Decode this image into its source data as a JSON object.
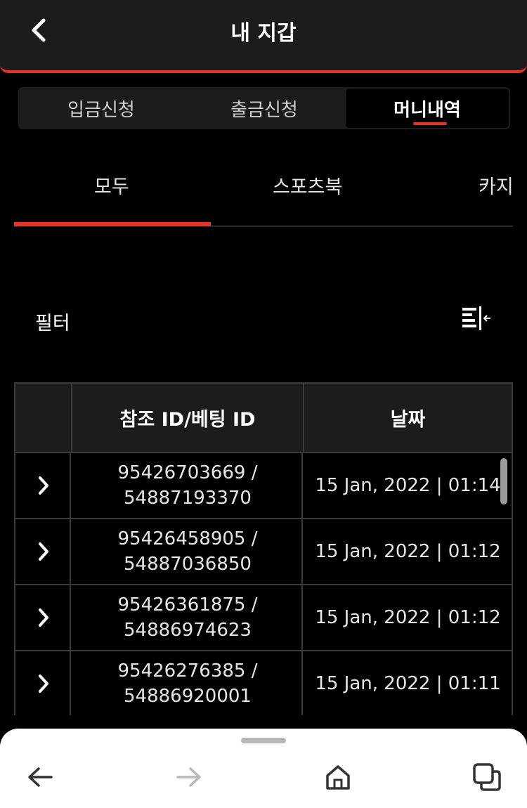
{
  "header": {
    "title": "내 지갑",
    "back_icon": "chevron-left-icon"
  },
  "segments": [
    {
      "label": "입금신청",
      "active": false
    },
    {
      "label": "출금신청",
      "active": false
    },
    {
      "label": "머니내역",
      "active": true
    }
  ],
  "category_tabs": [
    {
      "label": "모두",
      "active": true
    },
    {
      "label": "스포츠북",
      "active": false
    },
    {
      "label": "카지",
      "active": false
    }
  ],
  "filter": {
    "label": "필터",
    "icon": "filter-collapse-icon"
  },
  "table": {
    "columns": [
      "",
      "참조 ID/베팅 ID",
      "날짜"
    ],
    "rows": [
      {
        "ref_id": "95426703669 /",
        "bet_id": "54887193370",
        "date": "15 Jan, 2022 | 01:14"
      },
      {
        "ref_id": "95426458905 /",
        "bet_id": "54887036850",
        "date": "15 Jan, 2022 | 01:12"
      },
      {
        "ref_id": "95426361875 /",
        "bet_id": "54886974623",
        "date": "15 Jan, 2022 | 01:12"
      },
      {
        "ref_id": "95426276385 /",
        "bet_id": "54886920001",
        "date": "15 Jan, 2022 | 01:11"
      }
    ]
  },
  "browser_nav": {
    "items": [
      "back-arrow-icon",
      "forward-arrow-icon",
      "home-icon",
      "tabs-icon"
    ]
  },
  "colors": {
    "accent": "#e5332a",
    "surface": "#1c1c1e",
    "background": "#000000"
  }
}
